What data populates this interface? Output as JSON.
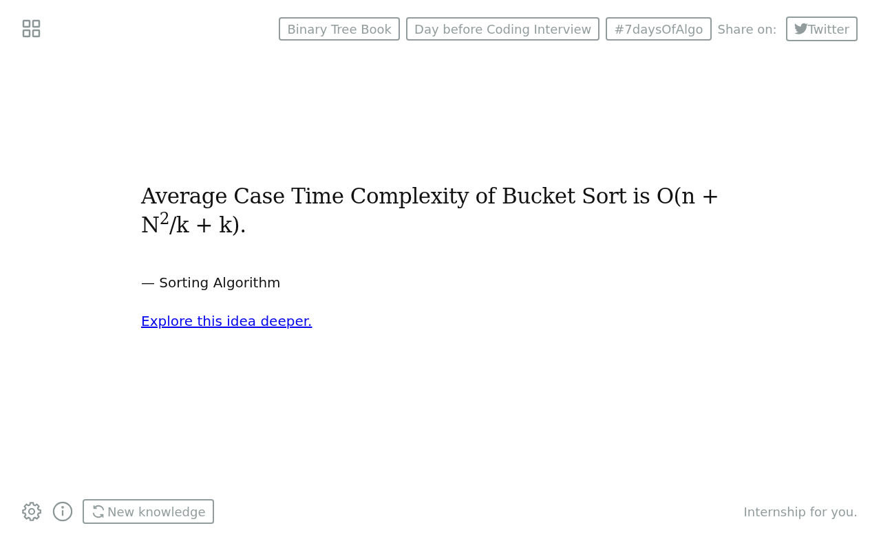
{
  "header": {
    "links": [
      "Binary Tree Book",
      "Day before Coding Interview",
      "#7daysOfAlgo"
    ],
    "share_label": "Share on:",
    "share_button": "Twitter"
  },
  "quote": {
    "text": "Average Case Time Complexity of Bucket Sort is O(n + N$^{2}$/k + k).",
    "source": "— Sorting Algorithm",
    "link": "Explore this idea deeper."
  },
  "footer": {
    "button": "New knowledge",
    "note": "Internship for you."
  }
}
